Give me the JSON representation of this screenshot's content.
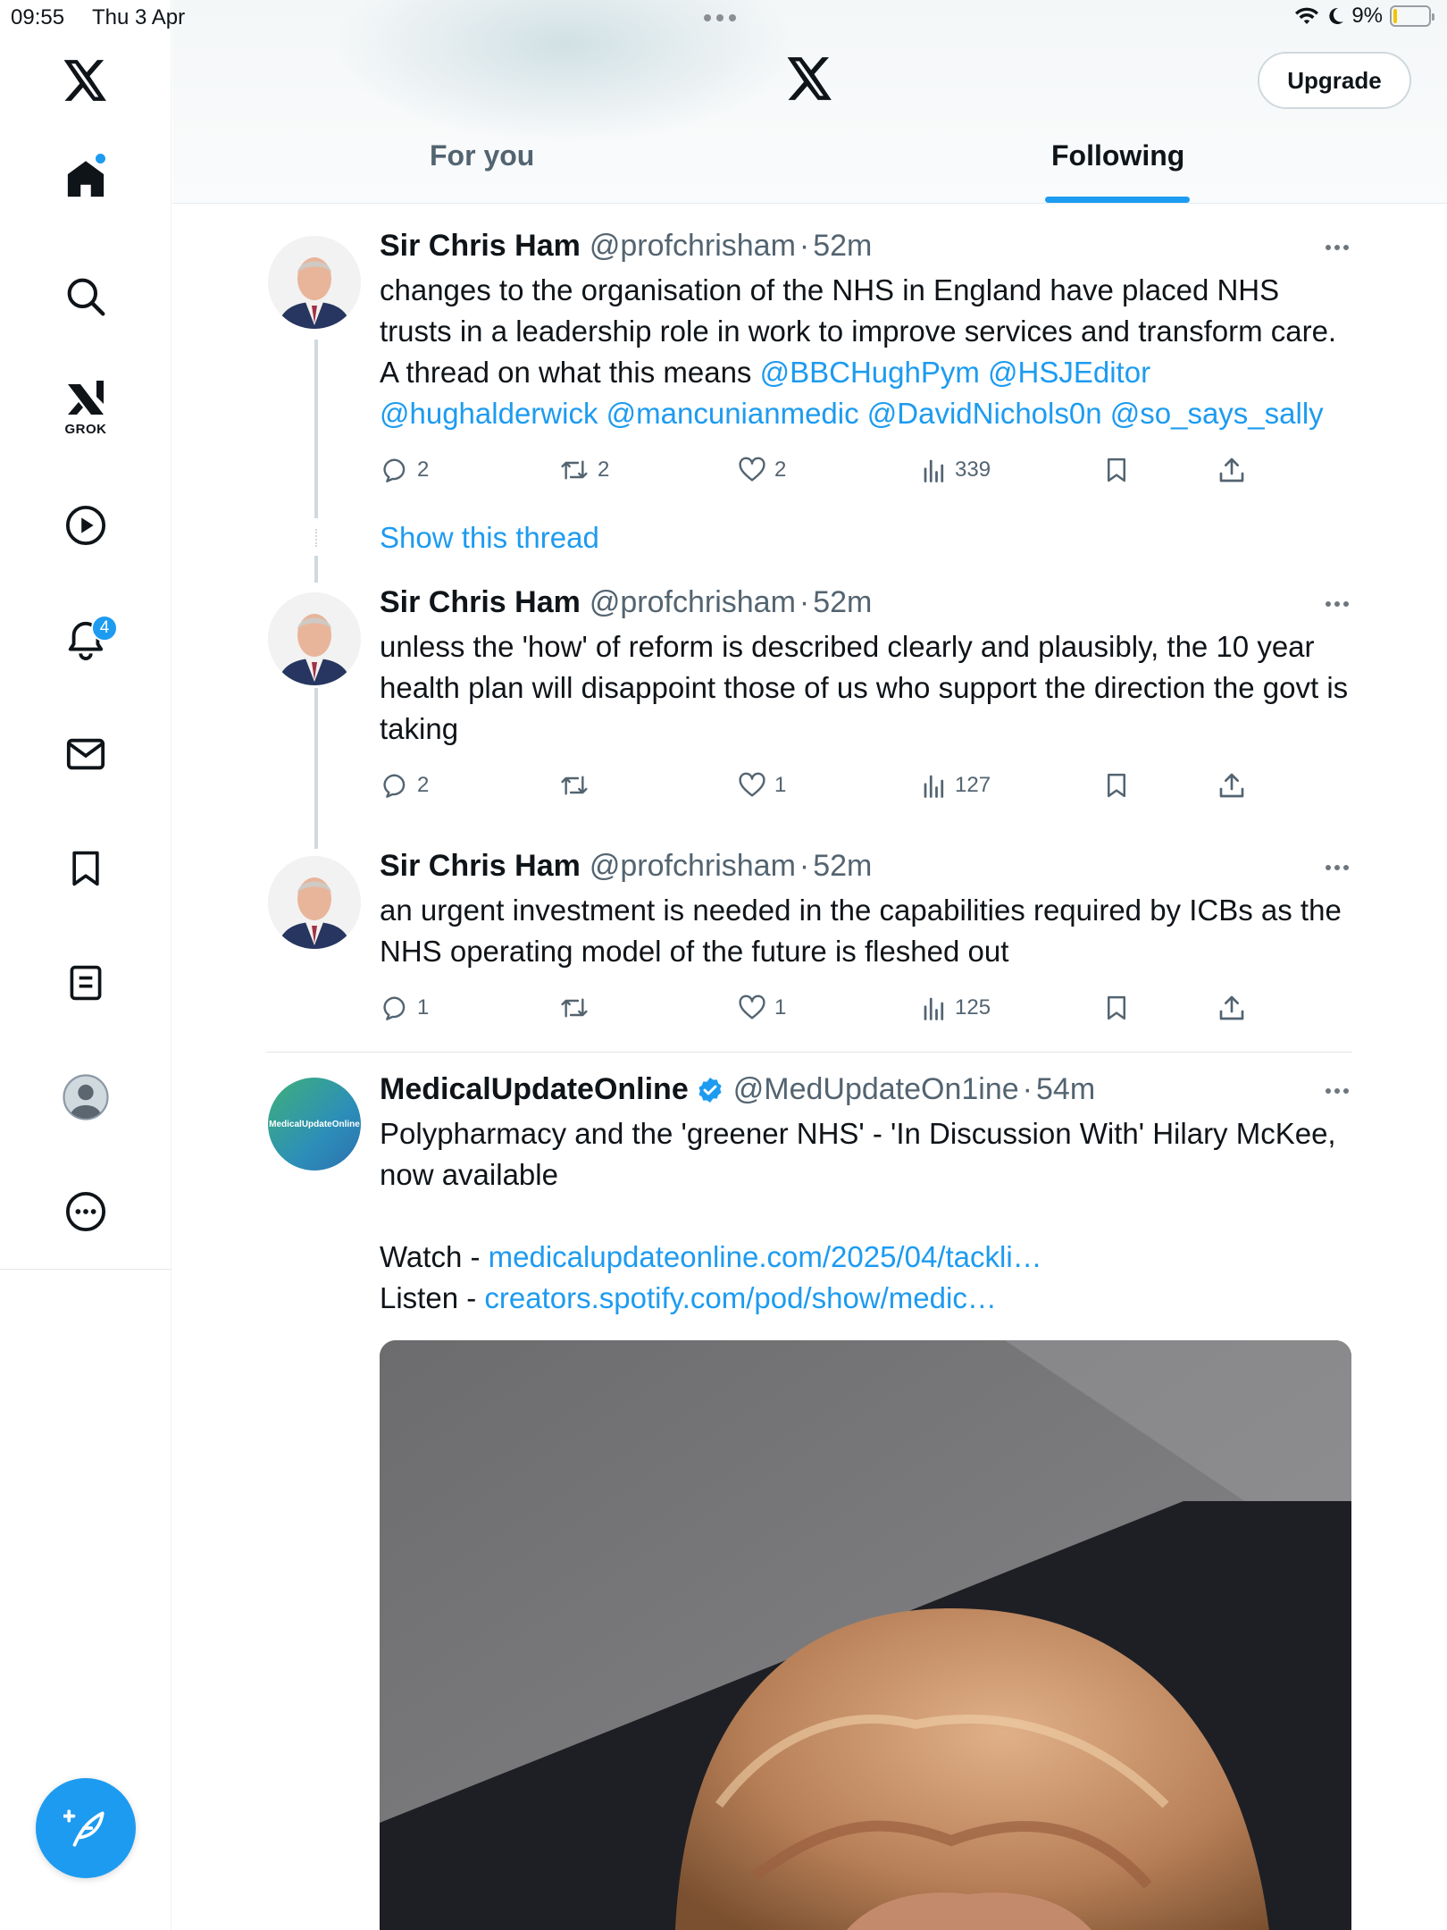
{
  "status_bar": {
    "time": "09:55",
    "date": "Thu 3 Apr",
    "battery_percent": "9%",
    "battery_level": 0.09
  },
  "sidebar": {
    "items": [
      {
        "name": "home",
        "icon": "home-icon"
      },
      {
        "name": "search",
        "icon": "search-icon"
      },
      {
        "name": "grok",
        "icon": "grok-icon",
        "label": "GROK"
      },
      {
        "name": "videos",
        "icon": "play-icon"
      },
      {
        "name": "notifications",
        "icon": "bell-icon",
        "badge": "4"
      },
      {
        "name": "messages",
        "icon": "mail-icon"
      },
      {
        "name": "bookmarks",
        "icon": "bookmark-icon"
      },
      {
        "name": "lists",
        "icon": "list-icon"
      },
      {
        "name": "profile",
        "icon": "avatar-icon"
      },
      {
        "name": "more",
        "icon": "more-circle-icon"
      }
    ]
  },
  "header": {
    "upgrade_label": "Upgrade",
    "tabs": [
      {
        "label": "For you",
        "active": false
      },
      {
        "label": "Following",
        "active": true
      }
    ]
  },
  "colors": {
    "accent": "#1d9bf0",
    "text": "#0f1419",
    "muted": "#536471"
  },
  "tweets": [
    {
      "name": "Sir Chris Ham",
      "handle": "@profchrisham",
      "time": "52m",
      "text_parts": [
        "changes to the organisation of the NHS in England have placed NHS trusts in a leadership role in work to improve services and transform care. A thread on what this means "
      ],
      "mentions": [
        "@BBCHughPym",
        "@HSJEditor",
        "@hughalderwick",
        "@mancunianmedic",
        "@DavidNichols0n",
        "@so_says_sally"
      ],
      "replies": "2",
      "reposts": "2",
      "likes": "2",
      "views": "339",
      "show_thread": "Show this thread"
    },
    {
      "name": "Sir Chris Ham",
      "handle": "@profchrisham",
      "time": "52m",
      "text": "unless the 'how' of reform is described clearly and plausibly, the 10 year health plan will disappoint those of us who support the direction the govt is taking",
      "replies": "2",
      "reposts": "",
      "likes": "1",
      "views": "127"
    },
    {
      "name": "Sir Chris Ham",
      "handle": "@profchrisham",
      "time": "52m",
      "text": "an urgent investment is needed in the capabilities required by ICBs as the NHS operating model of the future is fleshed out",
      "replies": "1",
      "reposts": "",
      "likes": "1",
      "views": "125"
    },
    {
      "name": "MedicalUpdateOnline",
      "handle": "@MedUpdateOn1ine",
      "time": "54m",
      "verified": true,
      "avatar_text": "MedicalUpdateOnline",
      "text": "Polypharmacy and the 'greener NHS' - 'In Discussion With' Hilary McKee, now available",
      "watch_label": "Watch - ",
      "watch_link": "medicalupdateonline.com/2025/04/tackli…",
      "listen_label": "Listen - ",
      "listen_link": "creators.spotify.com/pod/show/medic…"
    }
  ]
}
